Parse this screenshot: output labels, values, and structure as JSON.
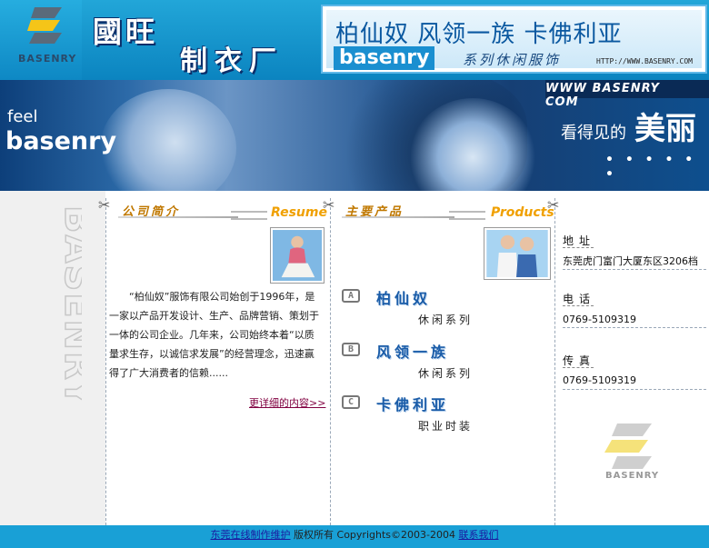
{
  "header": {
    "logo_text": "BASENRY",
    "company_name": "國旺",
    "company_suffix": "制衣厂",
    "banner_brands": "柏仙奴  风领一族  卡佛利亚",
    "banner_word": "basenry",
    "banner_series": "系列休闲服饰",
    "banner_url": "HTTP://WWW.BASENRY.COM"
  },
  "hero": {
    "url": "WWW BASENRY COM",
    "feel": "feel",
    "brand": "basenry",
    "slogan_lead": "看得见的",
    "slogan_main": "美丽",
    "dots": "• • • • • •"
  },
  "side": {
    "vertical_text": "BASENRY"
  },
  "intro": {
    "title_cn": "公司简介",
    "title_en": "Resume",
    "text": "“柏仙奴”服饰有限公司始创于1996年，是一家以产品开发设计、生产、品牌营销、策划于一体的公司企业。几年来，公司始终本着“以质量求生存，以诚信求发展”的经营理念，迅速赢得了广大消费者的信赖......",
    "more_link": "更详细的内容>>"
  },
  "products": {
    "title_cn": "主要产品",
    "title_en": "Products",
    "items": [
      {
        "badge": "A",
        "name": "柏仙奴",
        "sub": "休闲系列"
      },
      {
        "badge": "B",
        "name": "风领一族",
        "sub": "休闲系列"
      },
      {
        "badge": "C",
        "name": "卡佛利亚",
        "sub": "职业时装"
      }
    ]
  },
  "contact": {
    "address_label": "地址",
    "address": "东莞虎门富门大厦东区3206档",
    "phone_label": "电话",
    "phone": "0769-5109319",
    "fax_label": "传真",
    "fax": "0769-5109319",
    "logo_text": "BASENRY"
  },
  "footer": {
    "maker_link": "东莞在线制作维护",
    "copyright": " 版权所有 Copyrights©2003-2004 ",
    "contact_link": "联系我们"
  },
  "colors": {
    "header_blue": "#0b84c0",
    "footer_blue": "#19a0d6",
    "accent_orange": "#f0a000",
    "product_blue": "#1a5ca8"
  }
}
